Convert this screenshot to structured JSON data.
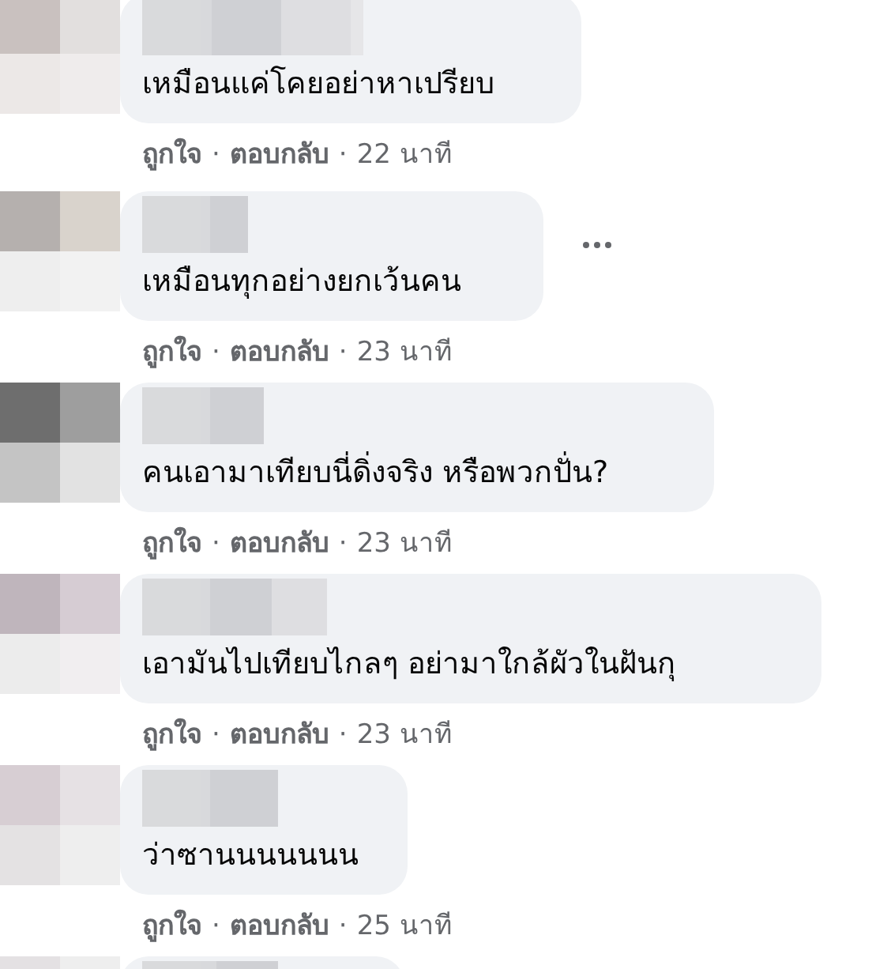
{
  "separator": "·",
  "comments": [
    {
      "text": "เหมือนแค่โคยอย่าหาเปรียบ",
      "like": "ถูกใจ",
      "reply": "ตอบกลับ",
      "time": "22 นาที",
      "menu": false
    },
    {
      "text": "เหมือนทุกอย่างยกเว้นคน",
      "like": "ถูกใจ",
      "reply": "ตอบกลับ",
      "time": "23 นาที",
      "menu": true
    },
    {
      "text": "คนเอามาเทียบนี่ดิ่งจริง หรือพวกปั่น?",
      "like": "ถูกใจ",
      "reply": "ตอบกลับ",
      "time": "23 นาที",
      "menu": false
    },
    {
      "text": "เอามันไปเทียบไกลๆ อย่ามาใกล้ผัวในฝันกุ",
      "like": "ถูกใจ",
      "reply": "ตอบกลับ",
      "time": "23 นาที",
      "menu": false
    },
    {
      "text": "ว่าซานนนนนนน",
      "like": "ถูกใจ",
      "reply": "ตอบกลับ",
      "time": "25 นาที",
      "menu": false
    },
    {
      "menu": false
    }
  ]
}
